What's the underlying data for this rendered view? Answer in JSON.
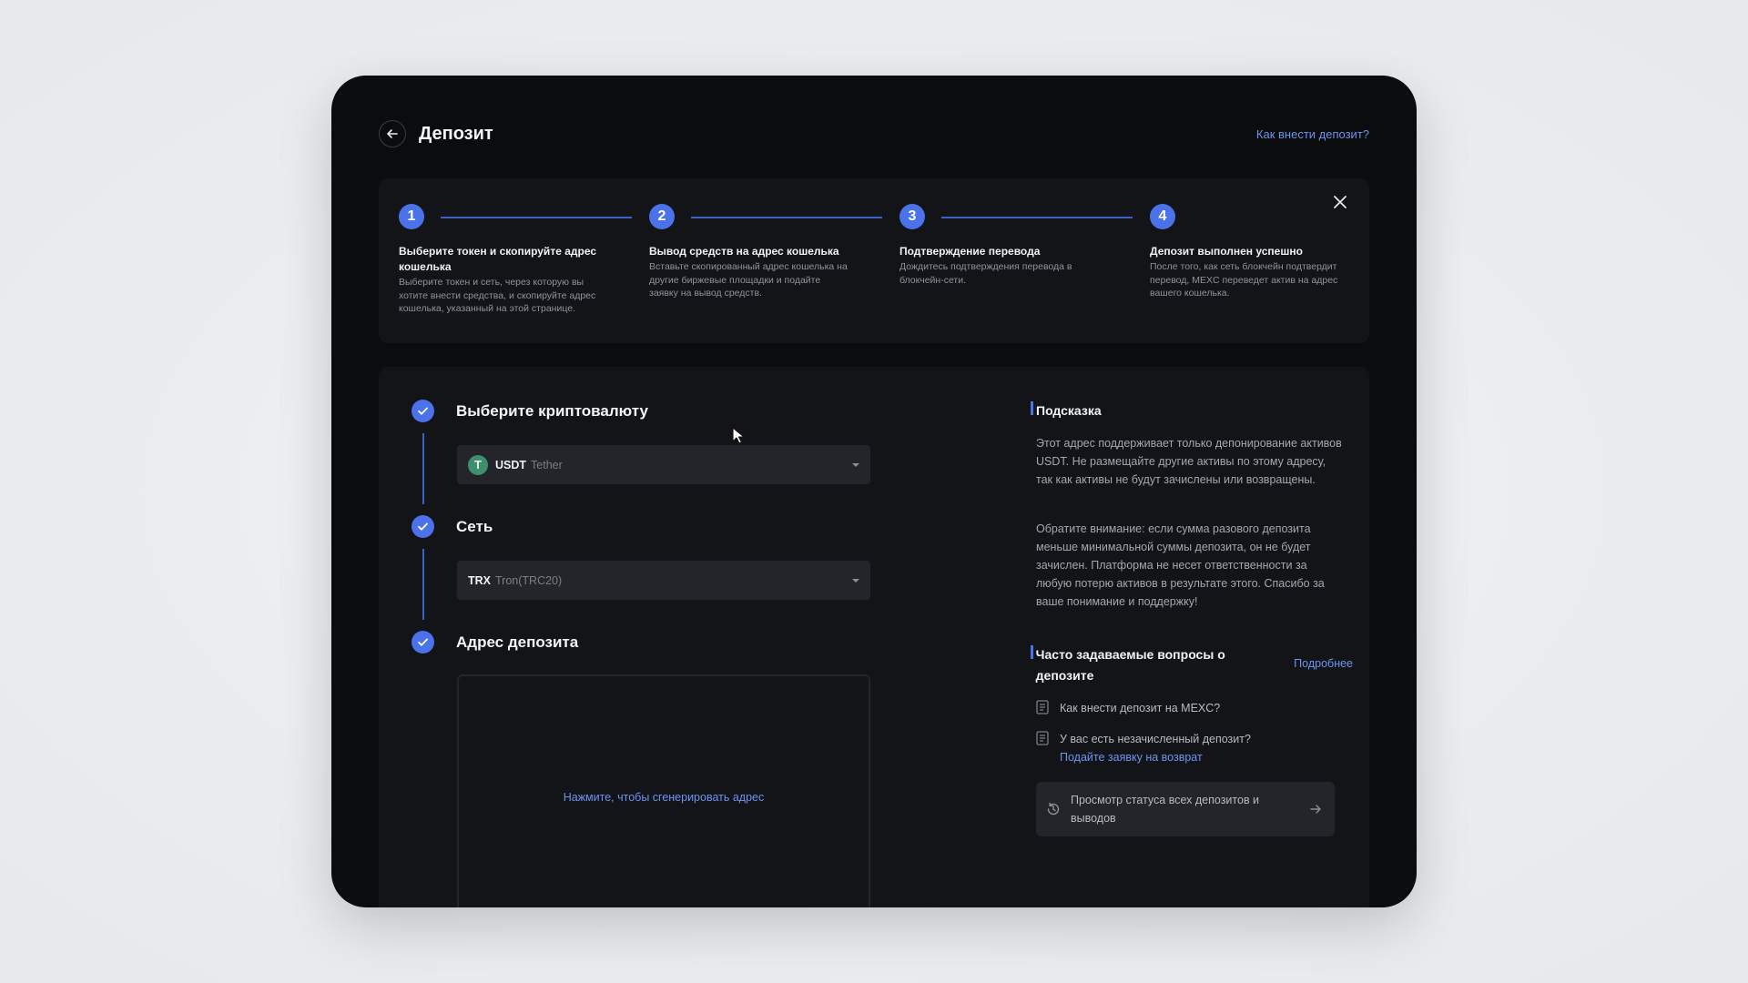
{
  "header": {
    "title": "Депозит",
    "help_link": "Как внести депозит?"
  },
  "steps": [
    {
      "number": "1",
      "title": "Выберите токен и скопируйте адрес кошелька",
      "description": "Выберите токен и сеть, через которую вы хотите внести средства, и скопируйте адрес кошелька, указанный на этой странице."
    },
    {
      "number": "2",
      "title": "Вывод средств на адрес кошелька",
      "description": "Вставьте скопированный адрес кошелька на другие биржевые площадки и подайте заявку на вывод средств."
    },
    {
      "number": "3",
      "title": "Подтверждение перевода",
      "description": "Дождитесь подтверждения перевода в блокчейн-сети."
    },
    {
      "number": "4",
      "title": "Депозит выполнен успешно",
      "description": "После того, как сеть блокчейн подтвердит перевод, MEXC переведет актив на адрес вашего кошелька."
    }
  ],
  "form": {
    "crypto_label": "Выберите криптовалюту",
    "crypto_icon_letter": "T",
    "crypto_symbol": "USDT",
    "crypto_name": "Tether",
    "network_label": "Сеть",
    "network_symbol": "TRX",
    "network_name": "Tron(TRC20)",
    "address_label": "Адрес депозита",
    "generate_link": "Нажмите, чтобы сгенерировать адрес"
  },
  "hint": {
    "title": "Подсказка",
    "paragraph1": "Этот адрес поддерживает только депонирование активов USDT. Не размещайте другие активы по этому адресу, так как активы не будут зачислены или возвращены.",
    "paragraph2": "Обратите внимание: если сумма разового депозита меньше минимальной суммы депозита, он не будет зачислен. Платформа не несет ответственности за любую потерю активов в результате этого. Спасибо за ваше понимание и поддержку!"
  },
  "faq": {
    "title": "Часто задаваемые вопросы о депозите",
    "more_link": "Подробнее",
    "item1": "Как внести депозит на MEXC?",
    "item2": "У вас есть незачисленный депозит?",
    "item2_link": "Подайте заявку на возврат",
    "status_button": "Просмотр статуса всех депозитов и выводов"
  },
  "colors": {
    "accent": "#4b72e8",
    "link": "#6e93f0",
    "frame_background": "#0b0c0e",
    "card_background": "#131418",
    "input_background": "#23252a",
    "token_icon": "#3f8f6e"
  },
  "icons": [
    "back-arrow-icon",
    "close-icon",
    "check-icon",
    "tether-icon",
    "chevron-down-icon",
    "document-icon",
    "history-icon",
    "arrow-right-icon",
    "mouse-cursor-icon"
  ]
}
